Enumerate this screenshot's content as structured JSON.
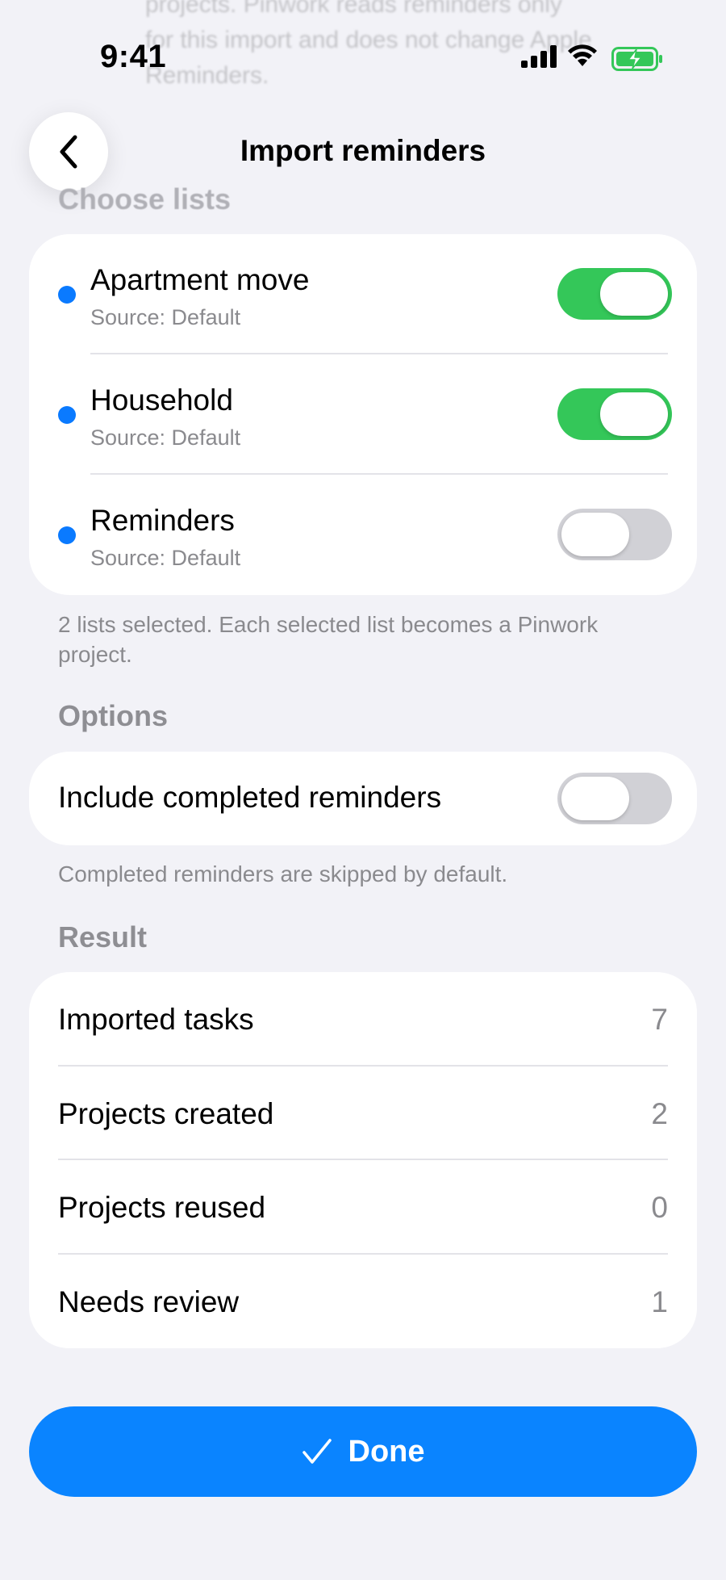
{
  "status_bar": {
    "time": "9:41",
    "icons": [
      "cellular-signal-icon",
      "wifi-icon",
      "battery-charging-icon"
    ]
  },
  "ghost_text": {
    "lines": [
      "projects. Pinwork reads reminders only",
      "for this import and does not change Apple",
      "Reminders."
    ]
  },
  "nav": {
    "title": "Import reminders",
    "back_icon": "chevron-left-icon"
  },
  "choose_lists": {
    "header": "Choose lists",
    "items": [
      {
        "name": "Apartment move",
        "source": "Source: Default",
        "selected": true
      },
      {
        "name": "Household",
        "source": "Source: Default",
        "selected": true
      },
      {
        "name": "Reminders",
        "source": "Source: Default",
        "selected": false
      }
    ],
    "footnote": "2 lists selected. Each selected list becomes a Pinwork project."
  },
  "options": {
    "header": "Options",
    "include_completed_label": "Include completed reminders",
    "include_completed": false,
    "footnote": "Completed reminders are skipped by default."
  },
  "result": {
    "header": "Result",
    "rows": [
      {
        "label": "Imported tasks",
        "value": "7"
      },
      {
        "label": "Projects created",
        "value": "2"
      },
      {
        "label": "Projects reused",
        "value": "0"
      },
      {
        "label": "Needs review",
        "value": "1"
      }
    ]
  },
  "done_button": {
    "label": "Done",
    "icon": "checkmark-icon"
  },
  "colors": {
    "accent": "#0a84ff",
    "toggle_on": "#34c759",
    "toggle_off": "#d1d1d6",
    "list_dot": "#0a7aff",
    "background": "#f2f2f7",
    "secondary_text": "#8a8a8e"
  }
}
